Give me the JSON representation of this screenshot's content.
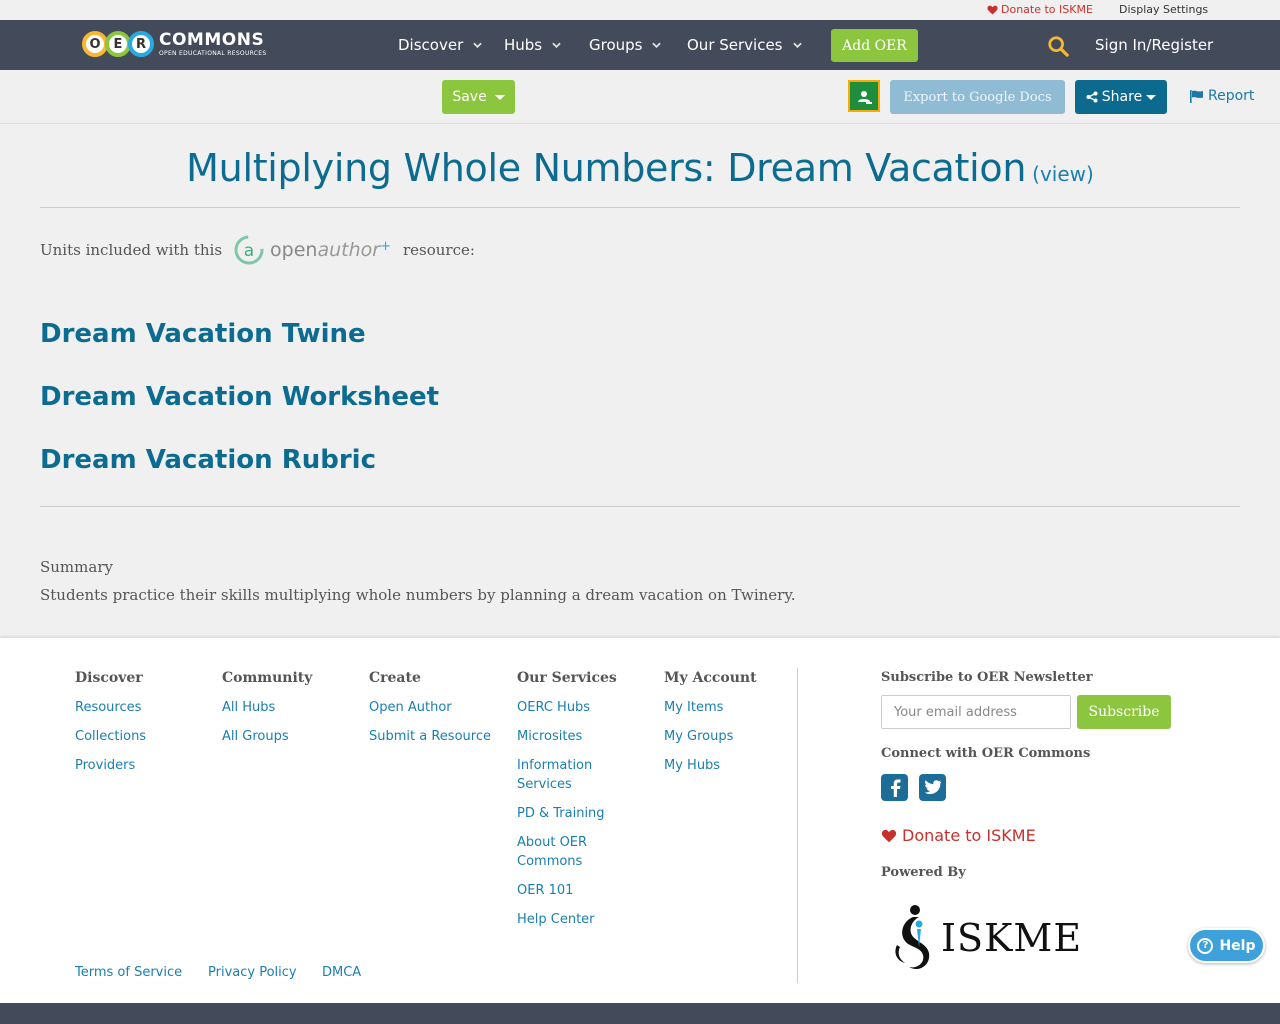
{
  "utility": {
    "donate": "Donate to ISKME",
    "display_settings": "Display Settings"
  },
  "nav": {
    "logo_letters": [
      "O",
      "E",
      "R"
    ],
    "logo_title": "COMMONS",
    "logo_subtitle": "OPEN EDUCATIONAL RESOURCES",
    "items": [
      {
        "label": "Discover"
      },
      {
        "label": "Hubs"
      },
      {
        "label": "Groups"
      },
      {
        "label": "Our Services"
      }
    ],
    "add_oer": "Add OER",
    "signin": "Sign In/Register",
    "icons": {
      "search": "search-icon",
      "chevron": "chevron-down-icon"
    }
  },
  "toolbar": {
    "save": "Save",
    "export": "Export to Google Docs",
    "share": "Share",
    "report": "Report"
  },
  "resource": {
    "title": "Multiplying Whole Numbers: Dream Vacation",
    "view": "(view)",
    "units_prefix": "Units included with this",
    "units_suffix": "resource:",
    "openauthor_a": "open",
    "openauthor_b": "author",
    "units": [
      "Dream Vacation Twine",
      "Dream Vacation Worksheet",
      "Dream Vacation Rubric"
    ],
    "summary_label": "Summary",
    "summary_text": "Students practice their skills multiplying whole numbers by planning a dream vacation on Twinery."
  },
  "footer": {
    "columns": [
      {
        "heading": "Discover",
        "links": [
          "Resources",
          "Collections",
          "Providers"
        ]
      },
      {
        "heading": "Community",
        "links": [
          "All Hubs",
          "All Groups"
        ]
      },
      {
        "heading": "Create",
        "links": [
          "Open Author",
          "Submit a Resource"
        ]
      },
      {
        "heading": "Our Services",
        "links": [
          "OERC Hubs",
          "Microsites",
          "Information Services",
          "PD & Training",
          "About OER Commons",
          "OER 101",
          "Help Center"
        ]
      },
      {
        "heading": "My Account",
        "links": [
          "My Items",
          "My Groups",
          "My Hubs"
        ]
      }
    ],
    "bottom_links": [
      "Terms of Service",
      "Privacy Policy",
      "DMCA"
    ],
    "newsletter_heading": "Subscribe to OER Newsletter",
    "email_placeholder": "Your email address",
    "subscribe": "Subscribe",
    "connect_heading": "Connect with OER Commons",
    "social": [
      "facebook-icon",
      "twitter-icon"
    ],
    "donate": "Donate to ISKME",
    "powered_by": "Powered By",
    "iskme": "ISKME"
  },
  "help": {
    "label": "Help"
  },
  "colors": {
    "nav_bg": "#434b5a",
    "green": "#8cc63f",
    "title_blue": "#0b6b91",
    "link_blue": "#1a7fb0",
    "donate_red": "#c9302c"
  }
}
